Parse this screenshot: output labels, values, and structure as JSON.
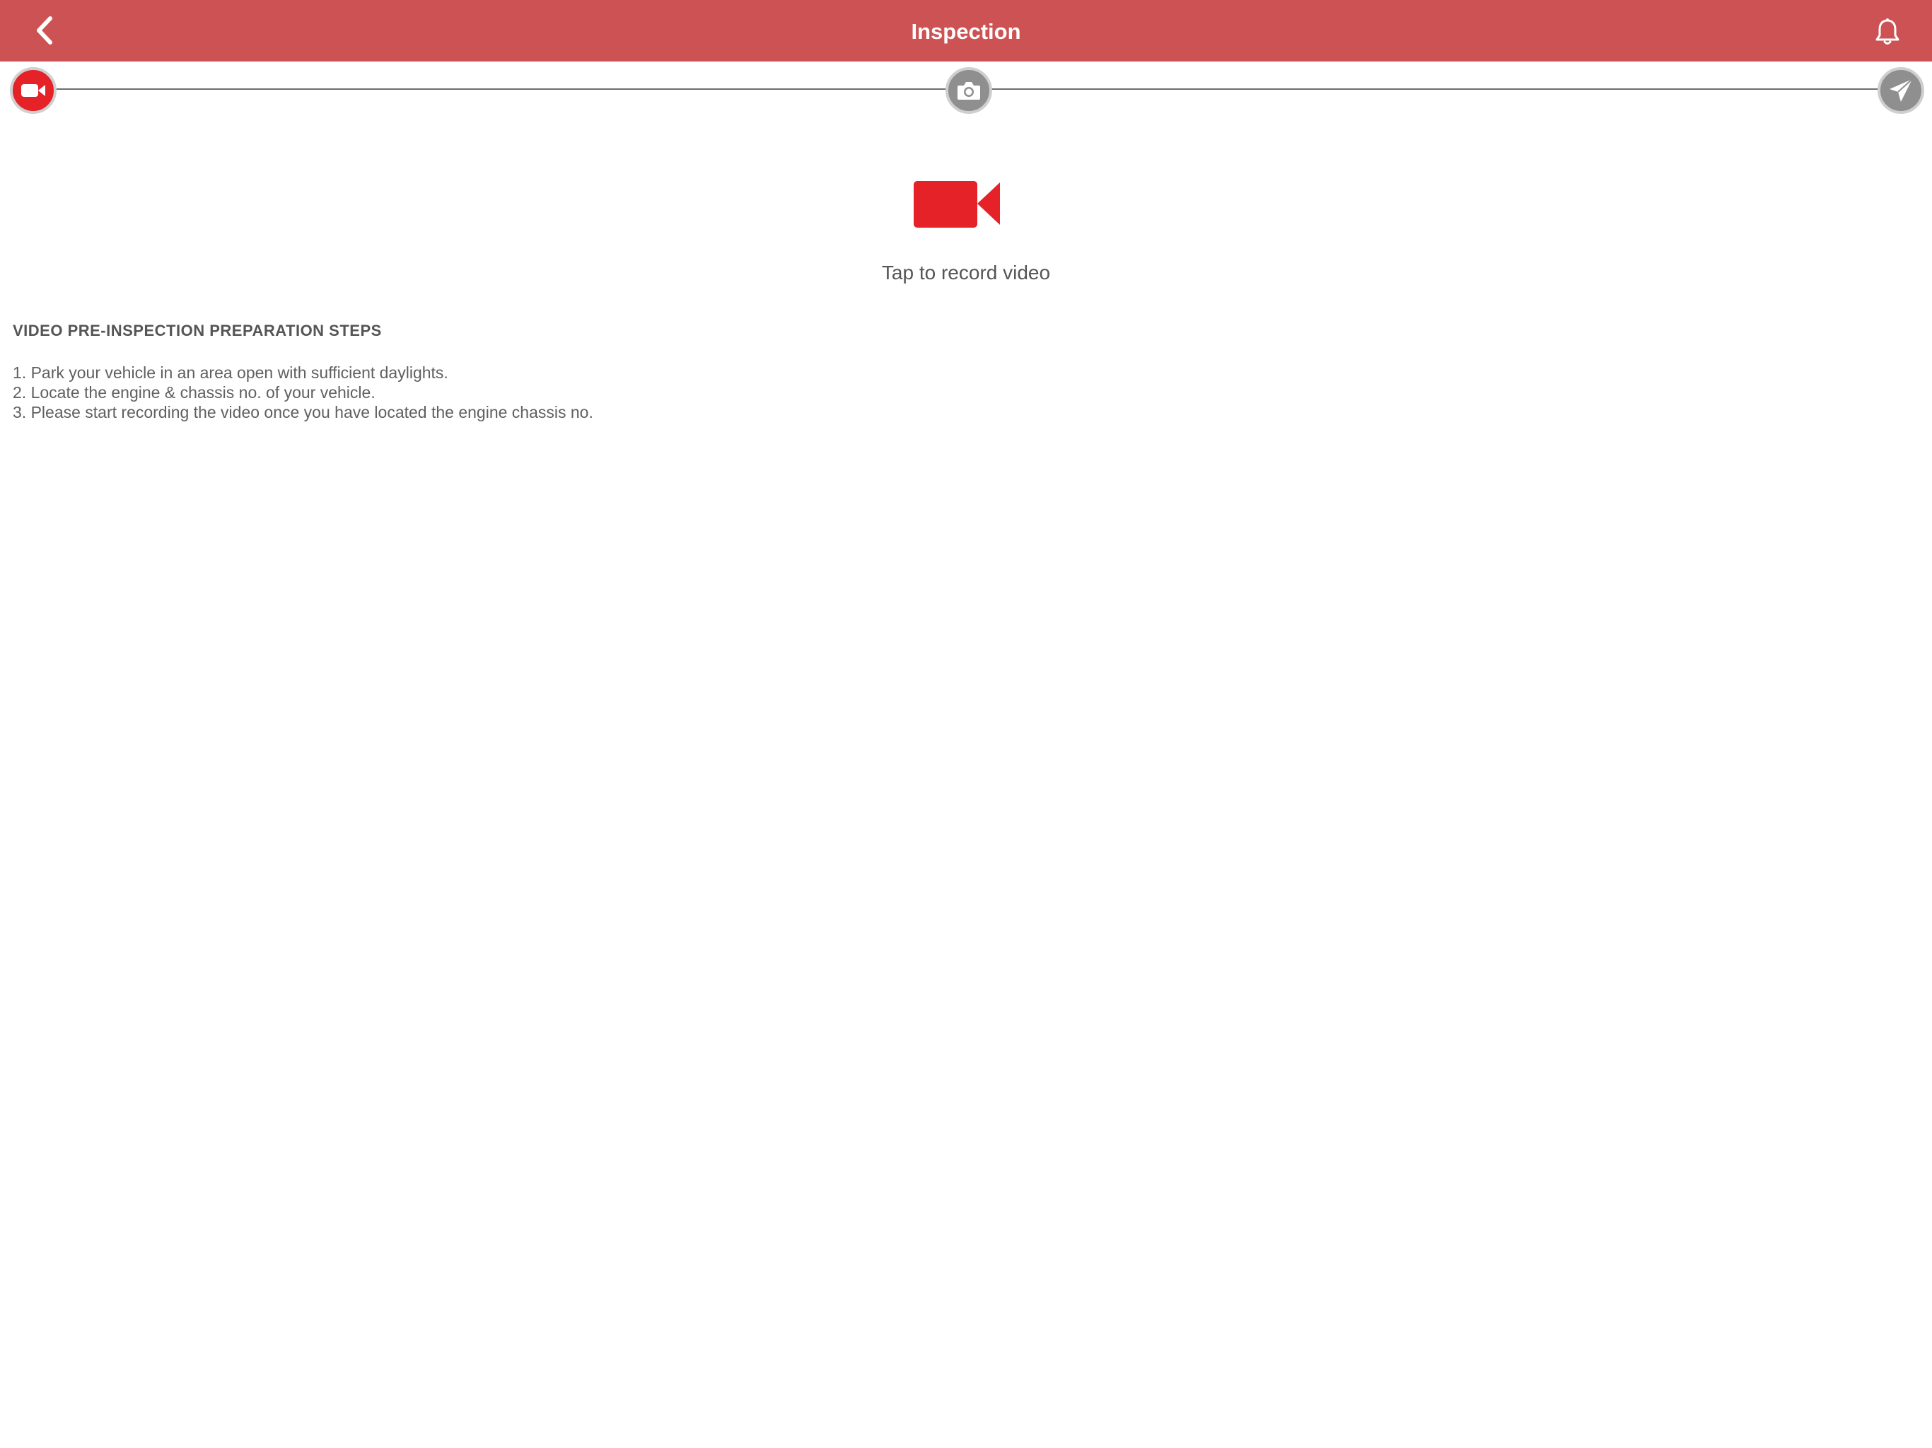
{
  "header": {
    "title": "Inspection",
    "back_icon": "chevron-left-icon",
    "bell_icon": "bell-icon",
    "bar_color": "#cd5253"
  },
  "stepper": {
    "steps": [
      {
        "icon": "video-camera-icon",
        "state": "active"
      },
      {
        "icon": "camera-icon",
        "state": "inactive"
      },
      {
        "icon": "paper-plane-icon",
        "state": "inactive"
      }
    ],
    "active_color": "#e42228",
    "inactive_color": "#8f8f8f"
  },
  "record": {
    "icon": "video-camera-icon",
    "label": "Tap to record video",
    "icon_color": "#e42228"
  },
  "instructions": {
    "title": "VIDEO PRE-INSPECTION PREPARATION STEPS",
    "items": [
      "1. Park your vehicle in an area open with sufficient daylights.",
      "2. Locate the engine & chassis no. of your vehicle.",
      "3. Please start recording the video once you have located the engine chassis no."
    ]
  }
}
